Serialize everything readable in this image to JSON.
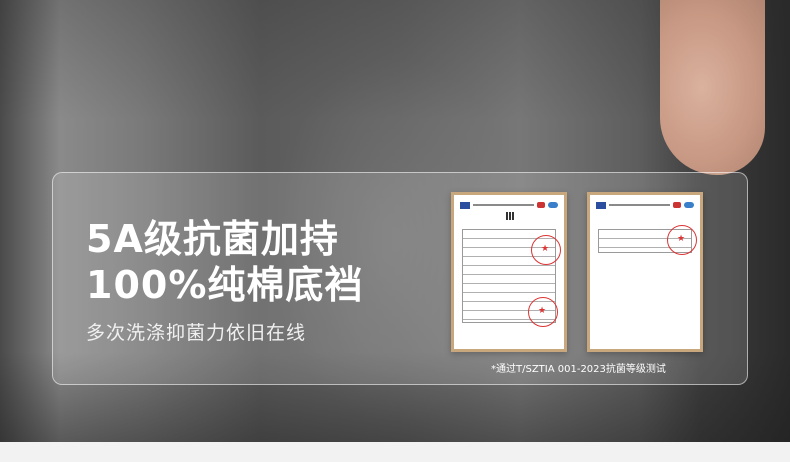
{
  "headline": {
    "line1": "5A级抗菌加持",
    "line2": "100%纯棉底裆"
  },
  "subline": "多次洗涤抑菌力依旧在线",
  "certificates": {
    "caption": "*通过T/SZTIA 001-2023抗菌等级测试",
    "count": 2
  },
  "colors": {
    "text_primary": "#ffffff",
    "frame": "#c8a77c",
    "stamp": "#dd3333"
  }
}
